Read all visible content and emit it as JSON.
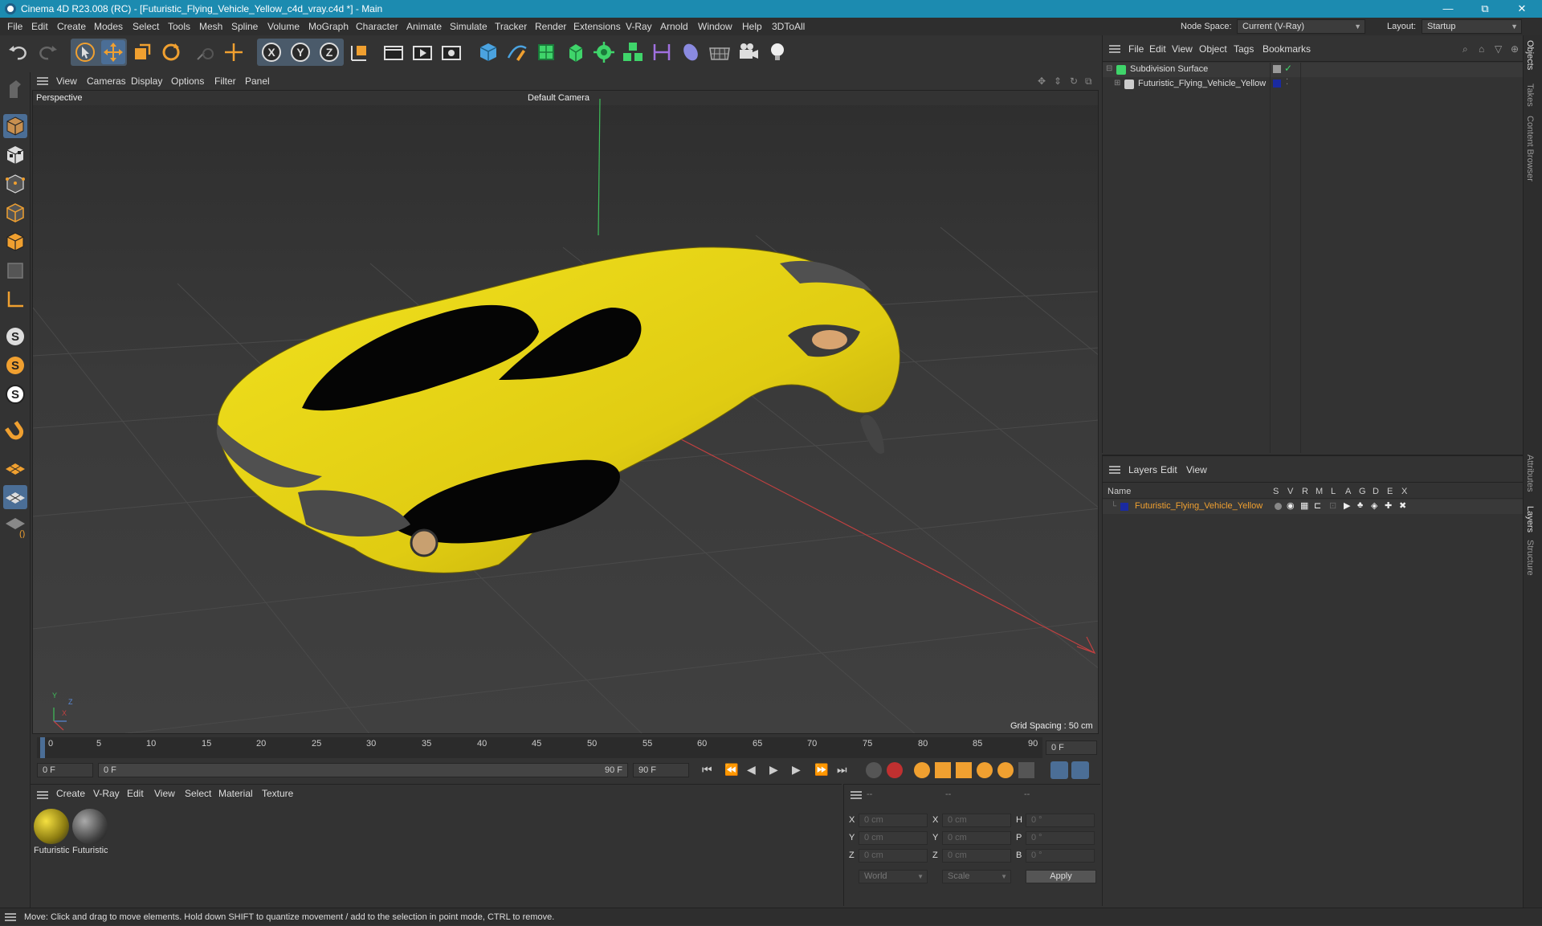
{
  "window": {
    "title": "Cinema 4D R23.008 (RC) - [Futuristic_Flying_Vehicle_Yellow_c4d_vray.c4d *] - Main",
    "minimize": "—",
    "maximize": "⧉",
    "close": "✕"
  },
  "menubar": {
    "items": [
      "File",
      "Edit",
      "Create",
      "Modes",
      "Select",
      "Tools",
      "Mesh",
      "Spline",
      "Volume",
      "MoGraph",
      "Character",
      "Animate",
      "Simulate",
      "Tracker",
      "Render",
      "Extensions",
      "V-Ray",
      "Arnold",
      "Window",
      "Help",
      "3DToAll"
    ],
    "node_space_label": "Node Space:",
    "node_space_value": "Current (V-Ray)",
    "layout_label": "Layout:",
    "layout_value": "Startup"
  },
  "viewport": {
    "menu": [
      "View",
      "Cameras",
      "Display",
      "Options",
      "Filter",
      "Panel"
    ],
    "view_name": "Perspective",
    "camera_name": "Default Camera",
    "grid_spacing": "Grid Spacing : 50 cm",
    "axis_y": "Y",
    "axis_z": "Z",
    "axis_x": "X"
  },
  "timeline": {
    "ticks": [
      "0",
      "5",
      "10",
      "15",
      "20",
      "25",
      "30",
      "35",
      "40",
      "45",
      "50",
      "55",
      "60",
      "65",
      "70",
      "75",
      "80",
      "85",
      "90"
    ],
    "current_frame_display": "0 F",
    "start_frame": "0 F",
    "range_start": "0 F",
    "range_end": "90 F",
    "end_frame": "90 F"
  },
  "material_manager": {
    "menu": [
      "Create",
      "V-Ray",
      "Edit",
      "View",
      "Select",
      "Material",
      "Texture"
    ],
    "materials": [
      {
        "label": "Futuristic",
        "color": "#b8a520"
      },
      {
        "label": "Futuristic",
        "color": "#555555"
      }
    ]
  },
  "coordinates": {
    "header": [
      "--",
      "--",
      "--"
    ],
    "rows": [
      {
        "axis": "X",
        "pos": "0 cm",
        "axis2": "X",
        "size": "0 cm",
        "rot_axis": "H",
        "rot": "0 °"
      },
      {
        "axis": "Y",
        "pos": "0 cm",
        "axis2": "Y",
        "size": "0 cm",
        "rot_axis": "P",
        "rot": "0 °"
      },
      {
        "axis": "Z",
        "pos": "0 cm",
        "axis2": "Z",
        "size": "0 cm",
        "rot_axis": "B",
        "rot": "0 °"
      }
    ],
    "mode_world": "World",
    "mode_scale": "Scale",
    "apply": "Apply"
  },
  "object_manager": {
    "menu": [
      "File",
      "Edit",
      "View",
      "Object",
      "Tags",
      "Bookmarks"
    ],
    "objects": [
      {
        "name": "Subdivision Surface"
      },
      {
        "name": "Futuristic_Flying_Vehicle_Yellow"
      }
    ]
  },
  "layer_manager": {
    "menu": [
      "Layers",
      "Edit",
      "View"
    ],
    "columns": [
      "Name",
      "S",
      "V",
      "R",
      "M",
      "L",
      "A",
      "G",
      "D",
      "E",
      "X"
    ],
    "layers": [
      {
        "name": "Futuristic_Flying_Vehicle_Yellow",
        "color": "#1a2aa0"
      }
    ]
  },
  "right_tabs": [
    "Objects",
    "Takes",
    "Content Browser",
    "Attributes",
    "Layers",
    "Structure"
  ],
  "status": {
    "text": "Move: Click and drag to move elements. Hold down SHIFT to quantize movement / add to the selection in point mode, CTRL to remove."
  },
  "colors": {
    "accent": "#4b6e96",
    "vehicle_yellow": "#e6d619",
    "layer_name": "#f0a030"
  }
}
